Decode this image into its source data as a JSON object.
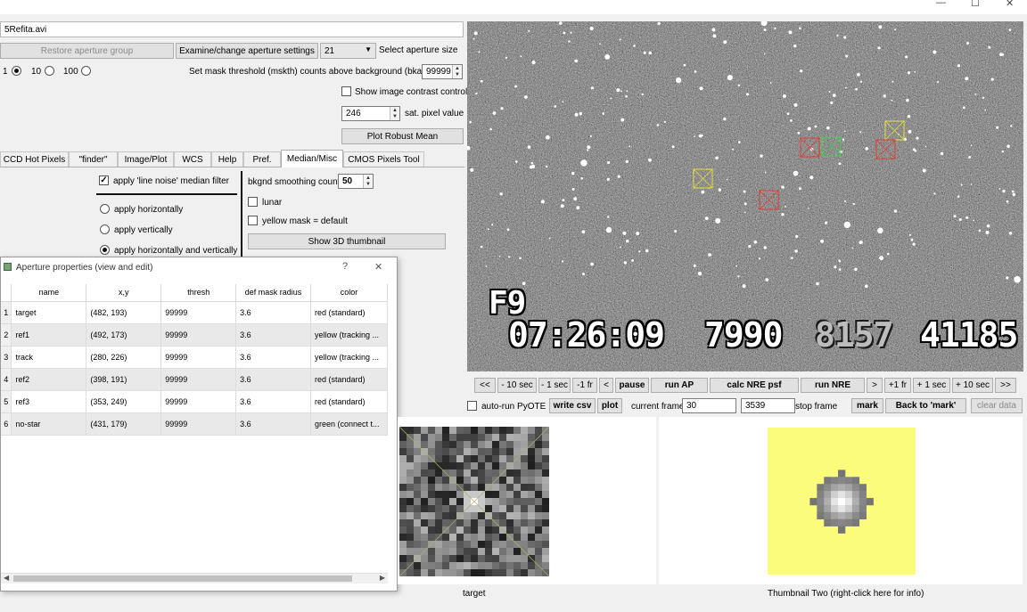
{
  "window": {
    "minimize_glyph": "—",
    "maximize_glyph": "☐",
    "close_glyph": "✕"
  },
  "file_name": "5Refita.avi",
  "controls": {
    "restore_aperture_group": "Restore aperture group",
    "examine_aperture_settings": "Examine/change aperture settings",
    "aperture_size_value": "21",
    "select_aperture_size": "Select aperture size",
    "radio_1": "1",
    "radio_10": "10",
    "radio_100": "100",
    "mask_threshold_label": "Set mask threshold (mskth) counts above background (bkavg)",
    "mask_threshold_value": "99999",
    "show_contrast_label": "Show image contrast control",
    "sat_pixel_value": "246",
    "sat_pixel_label": "sat. pixel value",
    "plot_robust_mean": "Plot Robust Mean"
  },
  "tabs": [
    "CCD Hot Pixels",
    "\"finder\"",
    "Image/Plot",
    "WCS",
    "Help",
    "Pref.",
    "Median/Misc",
    "CMOS Pixels Tool"
  ],
  "median": {
    "apply_line_noise": "apply 'line noise' median filter",
    "horizontally": "apply horizontally",
    "vertically": "apply vertically",
    "both": "apply horizontally and vertically",
    "bkgnd_label": "bkgnd smoothing count",
    "bkgnd_value": "50",
    "lunar": "lunar",
    "yellow_mask": "yellow mask = default",
    "show_3d": "Show 3D thumbnail"
  },
  "dialog": {
    "title": "Aperture properties (view and edit)",
    "help_glyph": "?",
    "close_glyph": "✕",
    "columns": [
      "name",
      "x,y",
      "thresh",
      "def mask radius",
      "color"
    ],
    "rows": [
      {
        "n": "1",
        "name": "target",
        "xy": "(482, 193)",
        "thresh": "99999",
        "radius": "3.6",
        "color": "red (standard)"
      },
      {
        "n": "2",
        "name": "ref1",
        "xy": "(492, 173)",
        "thresh": "99999",
        "radius": "3.6",
        "color": "yellow (tracking ..."
      },
      {
        "n": "3",
        "name": "track",
        "xy": "(280, 226)",
        "thresh": "99999",
        "radius": "3.6",
        "color": "yellow (tracking ..."
      },
      {
        "n": "4",
        "name": "ref2",
        "xy": "(398, 191)",
        "thresh": "99999",
        "radius": "3.6",
        "color": "red (standard)"
      },
      {
        "n": "5",
        "name": "ref3",
        "xy": "(353, 249)",
        "thresh": "99999",
        "radius": "3.6",
        "color": "red (standard)"
      },
      {
        "n": "6",
        "name": "no-star",
        "xy": "(431, 179)",
        "thresh": "99999",
        "radius": "3.6",
        "color": "green (connect t..."
      }
    ]
  },
  "video": {
    "overlay_field": "F9",
    "overlay_time": "07:26:09",
    "overlay_num1": "7990",
    "overlay_num2": "8157",
    "overlay_num3": "41185"
  },
  "playback": {
    "back_all": "<<",
    "back_10s": "- 10 sec",
    "back_1s": "- 1 sec",
    "back_1fr": "-1 fr",
    "back_step": "<",
    "pause": "pause",
    "run_ap": "run AP",
    "calc_nre_psf": "calc NRE psf",
    "run_nre": "run NRE",
    "fwd_step": ">",
    "fwd_1fr": "+1 fr",
    "fwd_1s": "+ 1 sec",
    "fwd_10s": "+ 10 sec",
    "fwd_all": ">>"
  },
  "bottom_controls": {
    "auto_run_pyote": "auto-run PyOTE",
    "write_csv": "write csv",
    "plot": "plot",
    "current_frame_label": "current frame",
    "current_frame_value": "30",
    "stop_frame_value": "3539",
    "stop_frame_label": "stop frame",
    "mark": "mark",
    "back_to_mark": "Back to 'mark'",
    "clear_data": "clear data"
  },
  "thumbnails": {
    "one_caption": "target",
    "two_caption": "Thumbnail Two (right-click here for info)"
  },
  "colors": {
    "aperture_red": "#e23b2e",
    "aperture_yellow": "#e8e03a",
    "aperture_green": "#3bd14a",
    "thumb_yellow": "#fbfc7c"
  }
}
